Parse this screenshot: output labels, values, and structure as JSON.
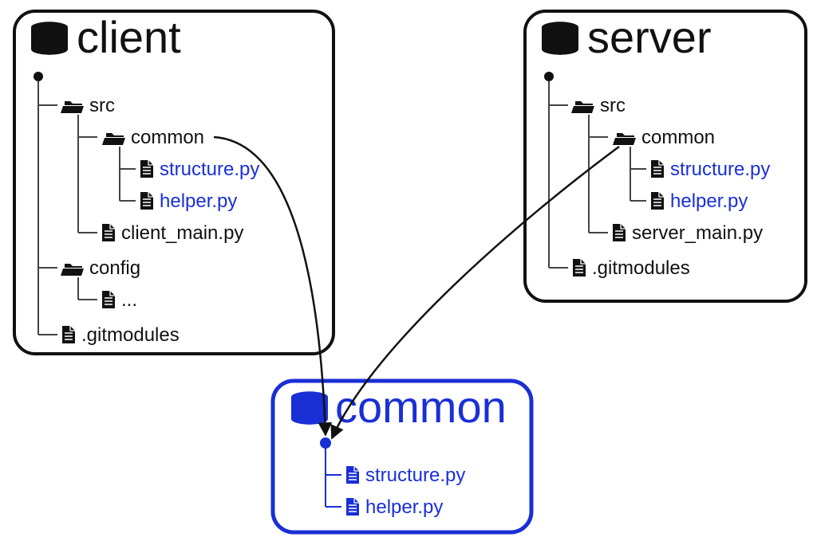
{
  "repos": {
    "client": {
      "title": "client",
      "color": "#111",
      "tree": {
        "src": {
          "label": "src",
          "type": "folder"
        },
        "common": {
          "label": "common",
          "type": "folder"
        },
        "structure": {
          "label": "structure.py",
          "type": "file",
          "shared": true
        },
        "helper": {
          "label": "helper.py",
          "type": "file",
          "shared": true
        },
        "client_main": {
          "label": "client_main.py",
          "type": "file"
        },
        "config": {
          "label": "config",
          "type": "folder"
        },
        "config_ellipsis": {
          "label": "...",
          "type": "file"
        },
        "gitmodules": {
          "label": ".gitmodules",
          "type": "file"
        }
      }
    },
    "server": {
      "title": "server",
      "color": "#111",
      "tree": {
        "src": {
          "label": "src",
          "type": "folder"
        },
        "common": {
          "label": "common",
          "type": "folder"
        },
        "structure": {
          "label": "structure.py",
          "type": "file",
          "shared": true
        },
        "helper": {
          "label": "helper.py",
          "type": "file",
          "shared": true
        },
        "server_main": {
          "label": "server_main.py",
          "type": "file"
        },
        "gitmodules": {
          "label": ".gitmodules",
          "type": "file"
        }
      }
    },
    "common": {
      "title": "common",
      "color": "#1a2fd6",
      "tree": {
        "structure": {
          "label": "structure.py",
          "type": "file",
          "shared": true
        },
        "helper": {
          "label": "helper.py",
          "type": "file",
          "shared": true
        }
      }
    }
  },
  "colors": {
    "shared": "#1a2fd6",
    "default": "#111",
    "line": "#444"
  }
}
